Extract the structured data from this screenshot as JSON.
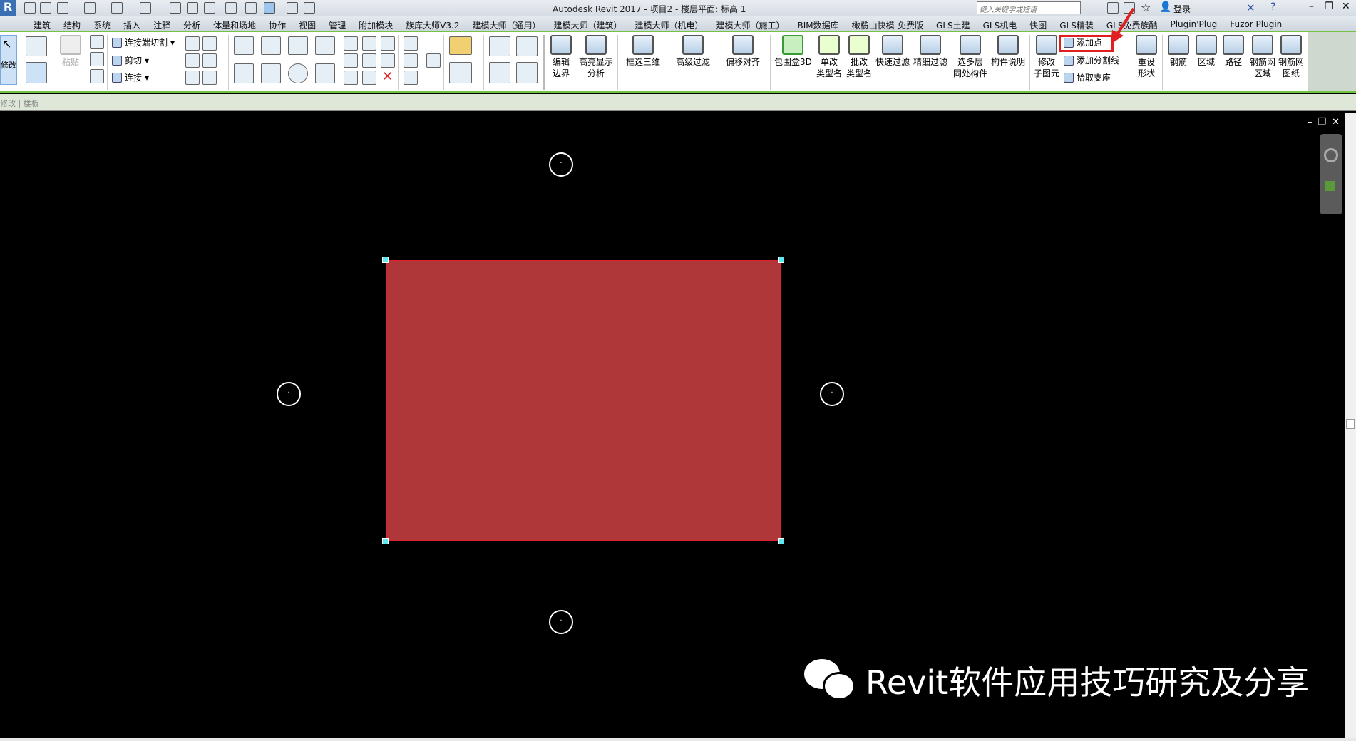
{
  "titlebar": {
    "title": "Autodesk Revit 2017 -     项目2 - 楼层平面: 标高 1",
    "search_placeholder": "键入关键字或短语",
    "login": "登录",
    "logo": "R"
  },
  "tabs": [
    "建筑",
    "结构",
    "系统",
    "插入",
    "注释",
    "分析",
    "体量和场地",
    "协作",
    "视图",
    "管理",
    "附加模块",
    "族库大师V3.2",
    "建模大师（通用）",
    "建模大师（建筑）",
    "建模大师（机电）",
    "建模大师（施工）",
    "BIM数据库",
    "橄榄山快模-免费版",
    "GLS土建",
    "GLS机电",
    "快图",
    "GLS精装",
    "GLS免费族酷",
    "Plugin'Plug",
    "Fuzor Plugin"
  ],
  "ribbon": {
    "modify": "修改",
    "paste": "粘贴",
    "cut_join": "连接端切割",
    "cut": "剪切",
    "join": "连接",
    "edit_boundary": [
      "编辑",
      "边界"
    ],
    "highlight": [
      "高亮显示",
      "分析"
    ],
    "box_3d": "框选三维",
    "adv_filter": "高级过滤",
    "offset_align": "偏移对齐",
    "bbox3d": "包围盒3D",
    "rename_type": [
      "单改",
      "类型名"
    ],
    "batch_rename": [
      "批改",
      "类型名"
    ],
    "quick_filter": "快速过滤",
    "fine_filter": "精细过滤",
    "multi_level": [
      "选多层",
      "同处构件"
    ],
    "comp_desc": "构件说明",
    "modify_sub": [
      "修改",
      "子图元"
    ],
    "add_point": "添加点",
    "add_split": "添加分割线",
    "pick_support": "拾取支座",
    "reset_shape": [
      "重设",
      "形状"
    ],
    "rebar": "钢筋",
    "area": "区域",
    "path": "路径",
    "fabric_area": [
      "钢筋网",
      "区域"
    ],
    "fabric_sheet": [
      "钢筋网",
      "图纸"
    ]
  },
  "options_bar": "修改 | 楼板",
  "watermark": "Revit软件应用技巧研究及分享",
  "colors": {
    "floor": "#b03739",
    "accent": "#72c440",
    "highlight": "#e02020"
  }
}
